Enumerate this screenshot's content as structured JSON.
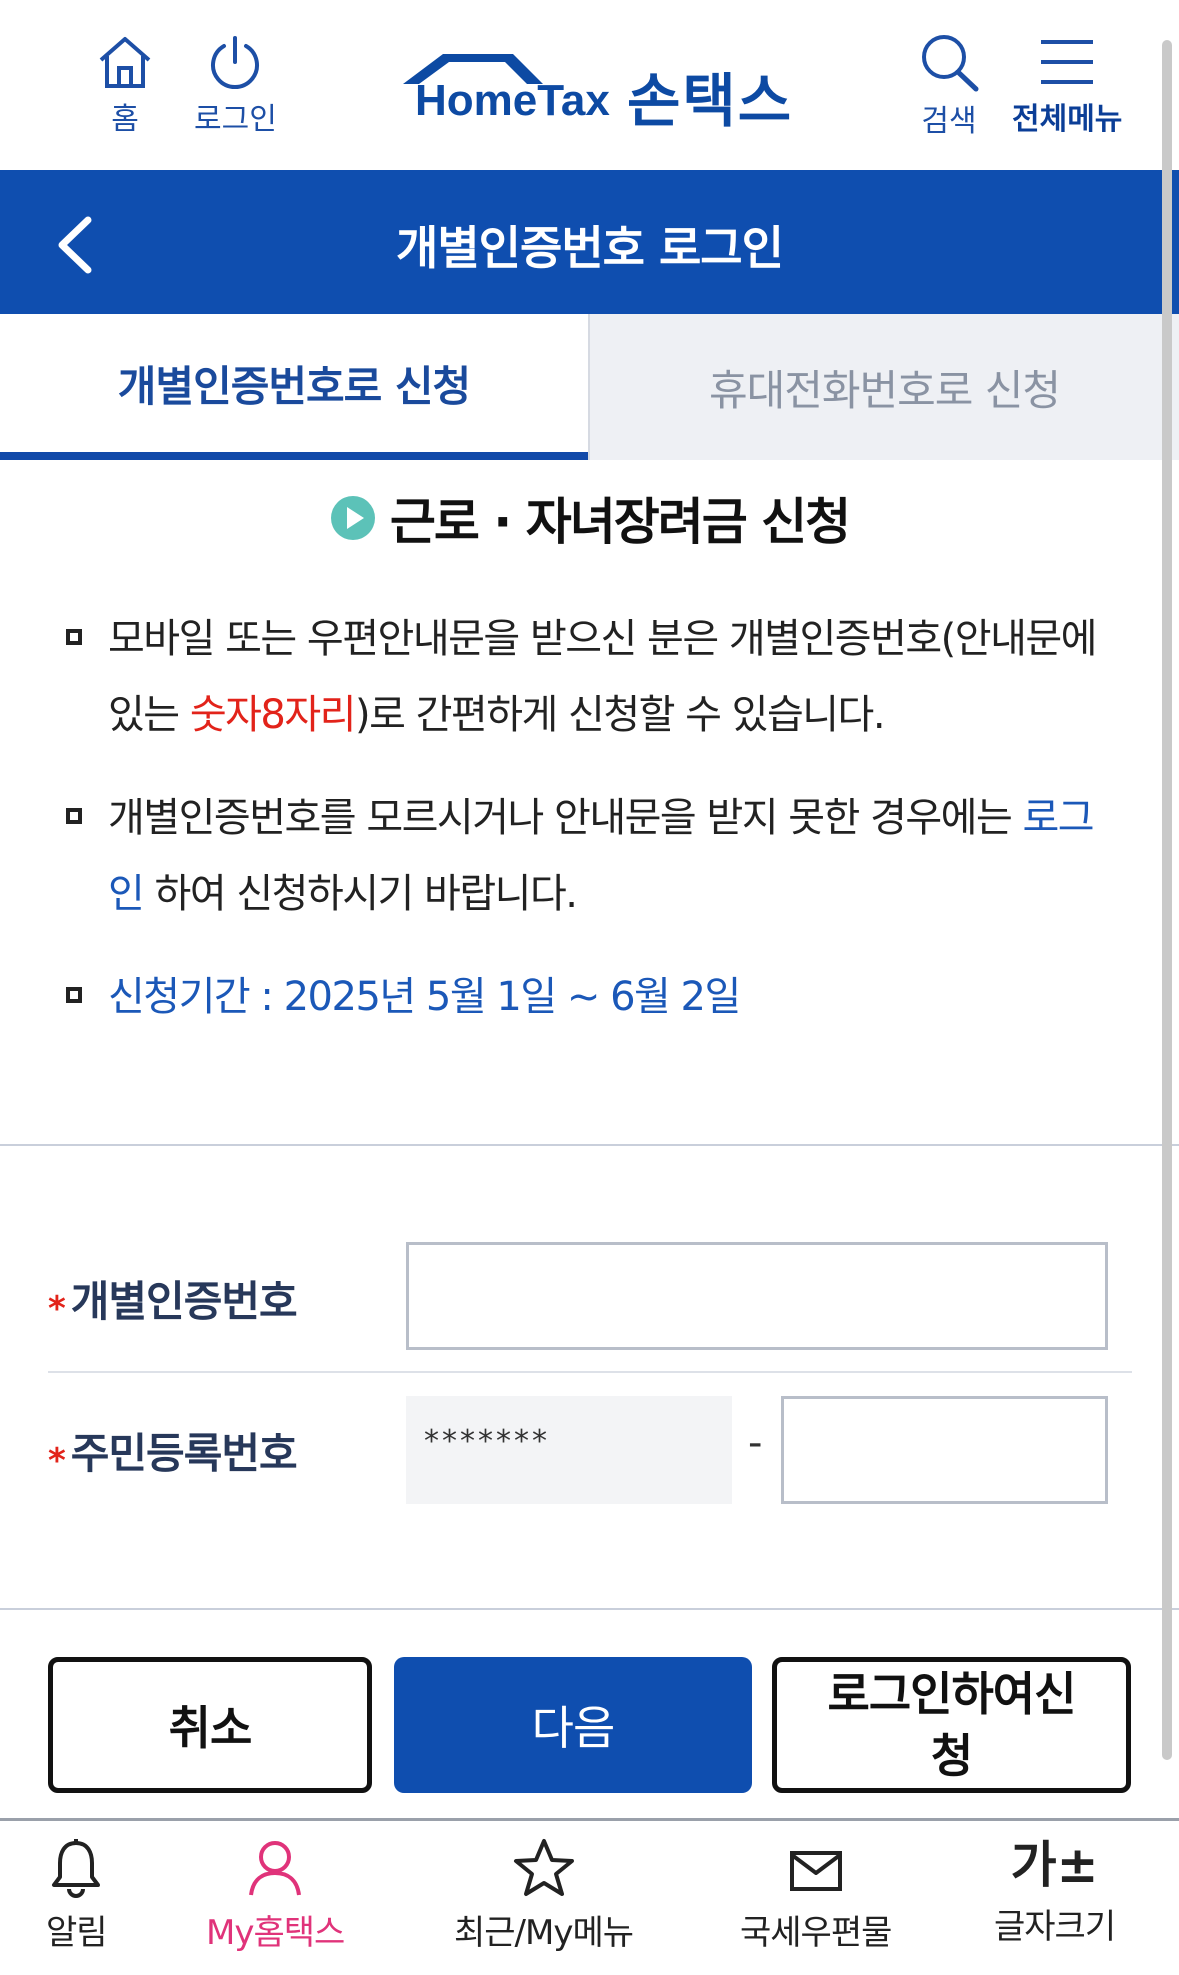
{
  "header": {
    "home_label": "홈",
    "login_label": "로그인",
    "logo_text": "HomeTax",
    "logo_ko": "손택스",
    "search_label": "검색",
    "menu_label": "전체메뉴"
  },
  "titlebar": {
    "title": "개별인증번호 로그인"
  },
  "tabs": [
    {
      "label": "개별인증번호로 신청",
      "active": true
    },
    {
      "label": "휴대전화번호로 신청",
      "active": false
    }
  ],
  "content": {
    "section_title": "근로 · 자녀장려금 신청",
    "bullet1_pre": "모바일 또는 우편안내문을 받으신 분은 개별인증번호(안내문에 있는 ",
    "bullet1_red": "숫자8자리",
    "bullet1_post": ")로 간편하게 신청할 수 있습니다.",
    "bullet2_pre": "개별인증번호를 모르시거나 안내문을 받지 못한 경우에는 ",
    "bullet2_link": "로그인",
    "bullet2_post": " 하여 신청하시기 바랍니다.",
    "bullet3": "신청기간 : 2025년 5월 1일 ~ 6월 2일"
  },
  "form": {
    "cert_label": "개별인증번호",
    "cert_value": "",
    "rrn_label": "주민등록번호",
    "rrn_front_masked": "*******",
    "rrn_dash": "-",
    "rrn_back_value": "",
    "required_mark": "*"
  },
  "buttons": {
    "cancel": "취소",
    "next": "다음",
    "login_apply": "로그인하여신청"
  },
  "bottomnav": {
    "items": [
      {
        "label": "알림",
        "icon": "bell-icon"
      },
      {
        "label": "My홈택스",
        "icon": "person-icon"
      },
      {
        "label": "최근/My메뉴",
        "icon": "star-icon"
      },
      {
        "label": "국세우편물",
        "icon": "mail-icon"
      },
      {
        "label": "글자크기",
        "icon": "font-size-icon",
        "glyph": "가±"
      }
    ]
  },
  "colors": {
    "primary": "#0f4eaf",
    "accent_red": "#e2231a",
    "active_pink": "#e0337a",
    "play_teal": "#5cc2b8"
  }
}
